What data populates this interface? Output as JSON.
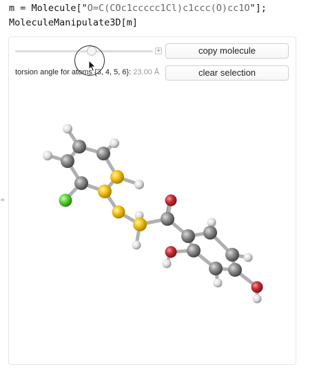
{
  "notebook": {
    "line1": {
      "prefix": "m = Molecule[\"",
      "smiles_a": "O=C(COc1ccccc1Cl)c1ccc(O)cc1O",
      "suffix": "\"];"
    },
    "line2": "MoleculeManipulate3D[m]",
    "output_marker": "="
  },
  "panel": {
    "slider_plus": "+",
    "copy_button": "copy molecule",
    "clear_button": "clear selection",
    "torsion_label": "torsion angle for atoms {3, 4, 5, 6}: ",
    "torsion_value": "23.00 Å"
  },
  "colors": {
    "carbon": "#8c8c8c",
    "hydrogen": "#e6e6e6",
    "oxygen": "#c62f36",
    "chlorine": "#5dd43a",
    "selected": "#f2c314"
  }
}
